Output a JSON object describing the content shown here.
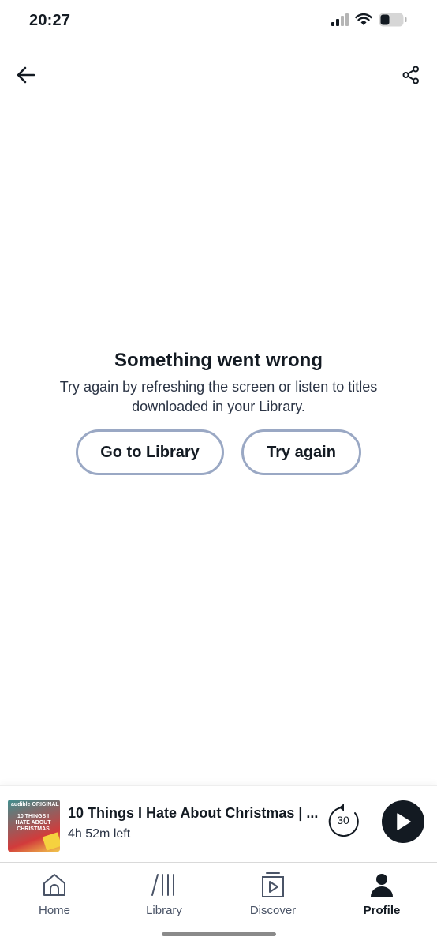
{
  "status_bar": {
    "time": "20:27"
  },
  "error": {
    "title": "Something went wrong",
    "message": "Try again by refreshing the screen or listen to titles downloaded in your Library.",
    "go_to_library_label": "Go to Library",
    "try_again_label": "Try again"
  },
  "mini_player": {
    "title": "10 Things I Hate About Christmas | ...",
    "time_left": "4h 52m left",
    "skip_back_seconds": "30",
    "cover_brand": "audible ORIGINAL",
    "cover_title": "10 THINGS I HATE ABOUT CHRISTMAS"
  },
  "tabs": [
    {
      "label": "Home",
      "icon": "home-icon",
      "active": false
    },
    {
      "label": "Library",
      "icon": "library-icon",
      "active": false
    },
    {
      "label": "Discover",
      "icon": "discover-icon",
      "active": false
    },
    {
      "label": "Profile",
      "icon": "profile-icon",
      "active": true
    }
  ],
  "colors": {
    "text": "#131a22",
    "button_border": "#9aa8c4",
    "play_button": "#131a22"
  }
}
